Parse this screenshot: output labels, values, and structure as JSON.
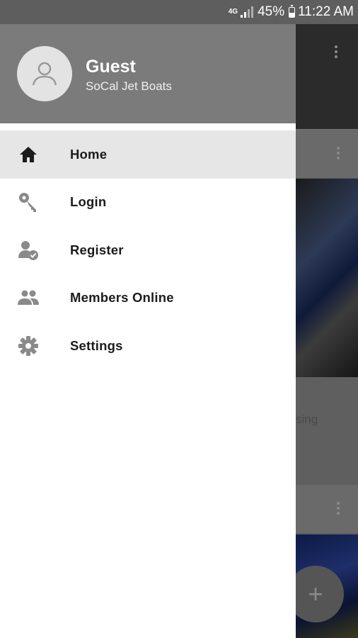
{
  "status_bar": {
    "network": "4G",
    "battery": "45%",
    "time": "11:22 AM"
  },
  "drawer": {
    "user": {
      "name": "Guest",
      "site": "SoCal Jet Boats"
    },
    "items": [
      {
        "label": "Home",
        "icon": "home-icon",
        "active": true
      },
      {
        "label": "Login",
        "icon": "key-icon",
        "active": false
      },
      {
        "label": "Register",
        "icon": "register-user-icon",
        "active": false
      },
      {
        "label": "Members Online",
        "icon": "group-icon",
        "active": false
      },
      {
        "label": "Settings",
        "icon": "gear-icon",
        "active": false
      }
    ]
  },
  "background": {
    "partial_text": "sing",
    "fab_icon": "+"
  },
  "colors": {
    "header_bg": "#7b7b7b",
    "active_item_bg": "#e6e6e6",
    "icon_color": "#8a8a8a"
  }
}
